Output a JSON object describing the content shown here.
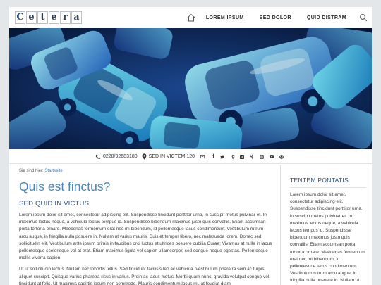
{
  "brand": {
    "letters": [
      "C",
      "e",
      "t",
      "e",
      "r",
      "a"
    ]
  },
  "nav": {
    "items": [
      {
        "label": "LOREM IPSUM"
      },
      {
        "label": "SED DOLOR"
      },
      {
        "label": "QUID DISTRAM"
      }
    ]
  },
  "contact": {
    "phone": "0228/92683180",
    "address": "SED IN VICTEM 120"
  },
  "social": [
    "mail-icon",
    "facebook-icon",
    "twitter-icon",
    "google-plus-icon",
    "linkedin-icon",
    "xing-icon",
    "instagram-icon",
    "youtube-icon",
    "pinterest-icon"
  ],
  "breadcrumb": {
    "prefix": "Sie sind hier:",
    "link": "Startseite"
  },
  "main": {
    "title": "Quis est finctus?",
    "subtitle": "SED QUID IN VICTUS",
    "p1": "Lorem ipsum dolor sit amet, consectetur adipiscing elit. Suspendisse tincidunt porttitor urna, in suscipit metus pulvinar et. In maximus lectus neque, a vehicula lectus tempus id. Suspendisse bibendum maximus justo quis convallis. Etiam accumsan porta tortor a ornare. Maecenas fermentum erat nec mi bibendum, id pellentesque lacus condimentum. Vestibulum rutrum arcu augue, in fringilla nulla posuere in. Nullam ut varius mauris. Duis et tempor libero, nec malesuada lorem. Donec sed sollicitudin elit. Vestibulum ante ipsum primis in faucibus orci luctus et ultrices posuere cubilia Curae; Vivamus at nulla in lacus pellentesque scelerisque vel at erat. Etiam maximus ligula vel sapien ullamcorper, sed congue neque egestas. Pellentesque mollis viverra sapien.",
    "p2": "Ut ut sollicitudin lectus. Nullam nec lobortis tellus. Sed tincidunt facilisis leo ac vehicula. Vestibulum pharetra sem ac turpis aliquet suscipit. Quisque varius pharetra risus in varius. Proin ac lacus metus. Morbi quam nunc, gravida volutpat congue vel, tincidunt at felis. Ut maximus sagittis ipsum non commodo. Mauris condimentum lacus mi, at feugiat diam"
  },
  "sidebar": {
    "title": "TENTEM PONTATIS",
    "text": "Lorem ipsum dolor sit amet, consectetur adipiscing elit. Suspendisse tincidunt porttitor urna, in suscipit metus pulvinar et. In maximus lectus neque, a vehicula lectus tempus id. Suspendisse bibendum maximus justo quis convallis. Etiam accumsan porta tortor a ornare. Maecenas fermentum erat nec mi bibendum, id pellentesque lacus condimentum. Vestibulum rutrum arcu augue, in fringilla nulla posuere in. Nullam ut varius mauris. Duis et"
  },
  "colors": {
    "accent": "#4a83b9",
    "heading": "#2c4c78",
    "link": "#3a7bbf"
  }
}
